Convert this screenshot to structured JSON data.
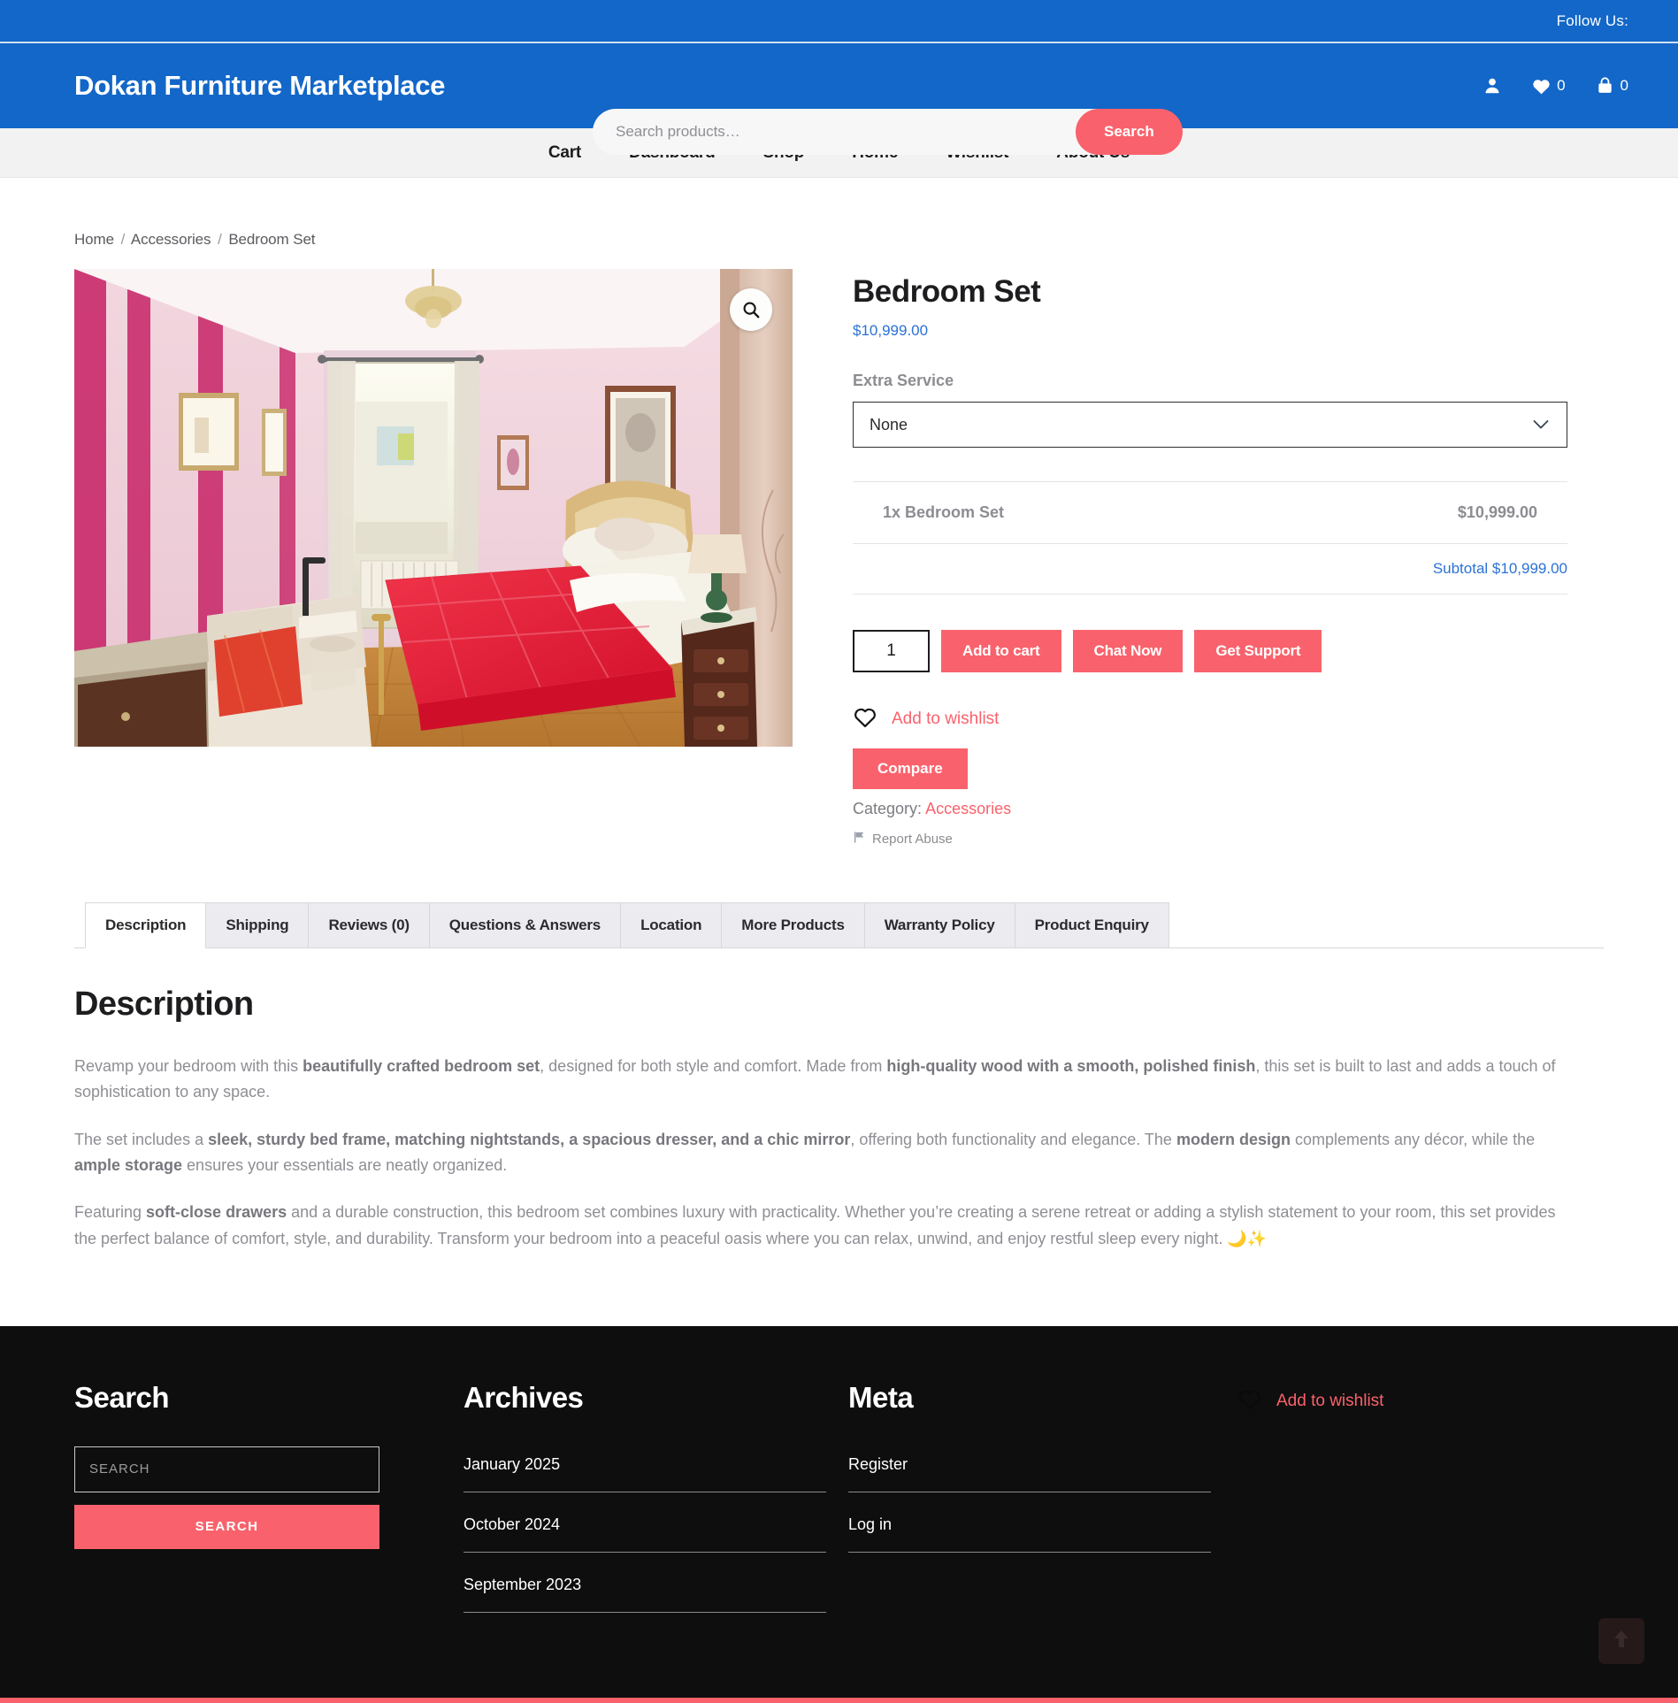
{
  "topbar": {
    "follow_label": "Follow Us:"
  },
  "header": {
    "brand": "Dokan Furniture Marketplace",
    "search_placeholder": "Search products…",
    "search_value": "",
    "search_button": "Search",
    "account_icon": "user-icon",
    "wishlist_icon": "heart-icon",
    "wishlist_count": "0",
    "cart_icon": "shopping-bag-icon",
    "cart_count": "0"
  },
  "nav": {
    "items": [
      {
        "label": "Cart"
      },
      {
        "label": "Dashboard"
      },
      {
        "label": "Shop"
      },
      {
        "label": "Home"
      },
      {
        "label": "Wishlist"
      },
      {
        "label": "About Us"
      }
    ]
  },
  "breadcrumb": {
    "home": "Home",
    "sep1": "/",
    "category": "Accessories",
    "sep2": "/",
    "current": "Bedroom Set"
  },
  "gallery": {
    "zoom_icon": "magnifier-icon",
    "alt": "Pink bedroom with red bedspread, chandelier, framed pictures and wooden nightstand"
  },
  "product": {
    "title": "Bedroom Set",
    "price": "$10,999.00",
    "extra_service_label": "Extra Service",
    "extra_service_value": "None",
    "extra_service_options": [
      "None"
    ],
    "addon_item_label": "1x Bedroom Set",
    "addon_item_price": "$10,999.00",
    "subtotal_label": "Subtotal $10,999.00",
    "quantity": "1",
    "add_to_cart": "Add to cart",
    "chat_now": "Chat Now",
    "get_support": "Get Support",
    "add_to_wishlist": "Add to wishlist",
    "wishlist_icon": "heart-outline-icon",
    "compare": "Compare",
    "category_label": "Category:",
    "category_value": "Accessories",
    "report_abuse": "Report Abuse",
    "report_icon": "flag-icon"
  },
  "tabs": {
    "items": [
      {
        "label": "Description",
        "active": true
      },
      {
        "label": "Shipping",
        "active": false
      },
      {
        "label": "Reviews (0)",
        "active": false
      },
      {
        "label": "Questions & Answers",
        "active": false
      },
      {
        "label": "Location",
        "active": false
      },
      {
        "label": "More Products",
        "active": false
      },
      {
        "label": "Warranty Policy",
        "active": false
      },
      {
        "label": "Product Enquiry",
        "active": false
      }
    ]
  },
  "description": {
    "heading": "Description",
    "p1_a": "Revamp your bedroom with this ",
    "p1_b": "beautifully crafted bedroom set",
    "p1_c": ", designed for both style and comfort. Made from ",
    "p1_d": "high-quality wood with a smooth, polished finish",
    "p1_e": ", this set is built to last and adds a touch of sophistication to any space.",
    "p2_a": "The set includes a ",
    "p2_b": "sleek, sturdy bed frame, matching nightstands, a spacious dresser, and a chic mirror",
    "p2_c": ", offering both functionality and elegance. The ",
    "p2_d": "modern design",
    "p2_e": " complements any décor, while the ",
    "p2_f": "ample storage",
    "p2_g": " ensures your essentials are neatly organized.",
    "p3_a": "Featuring ",
    "p3_b": "soft-close drawers",
    "p3_c": " and a durable construction, this bedroom set combines luxury with practicality. Whether you’re creating a serene retreat or adding a stylish statement to your room, this set provides the perfect balance of comfort, style, and durability. Transform your bedroom into a peaceful oasis where you can relax, unwind, and enjoy restful sleep every night. 🌙✨"
  },
  "footer": {
    "search": {
      "heading": "Search",
      "placeholder": "SEARCH",
      "value": "",
      "button": "SEARCH"
    },
    "archives": {
      "heading": "Archives",
      "items": [
        {
          "label": "January 2025"
        },
        {
          "label": "October 2024"
        },
        {
          "label": "September 2023"
        }
      ]
    },
    "meta": {
      "heading": "Meta",
      "items": [
        {
          "label": "Register"
        },
        {
          "label": "Log in"
        }
      ]
    },
    "wishlist": {
      "icon": "heart-outline-icon",
      "label": "Add to wishlist"
    },
    "scroll_top_icon": "arrow-up-icon"
  },
  "colors": {
    "brand_blue": "#1267C8",
    "accent_coral": "#F9626C",
    "link_blue": "#2a72d4",
    "footer_bg": "#0e0e0e",
    "nav_bg": "#f2f2f2"
  }
}
